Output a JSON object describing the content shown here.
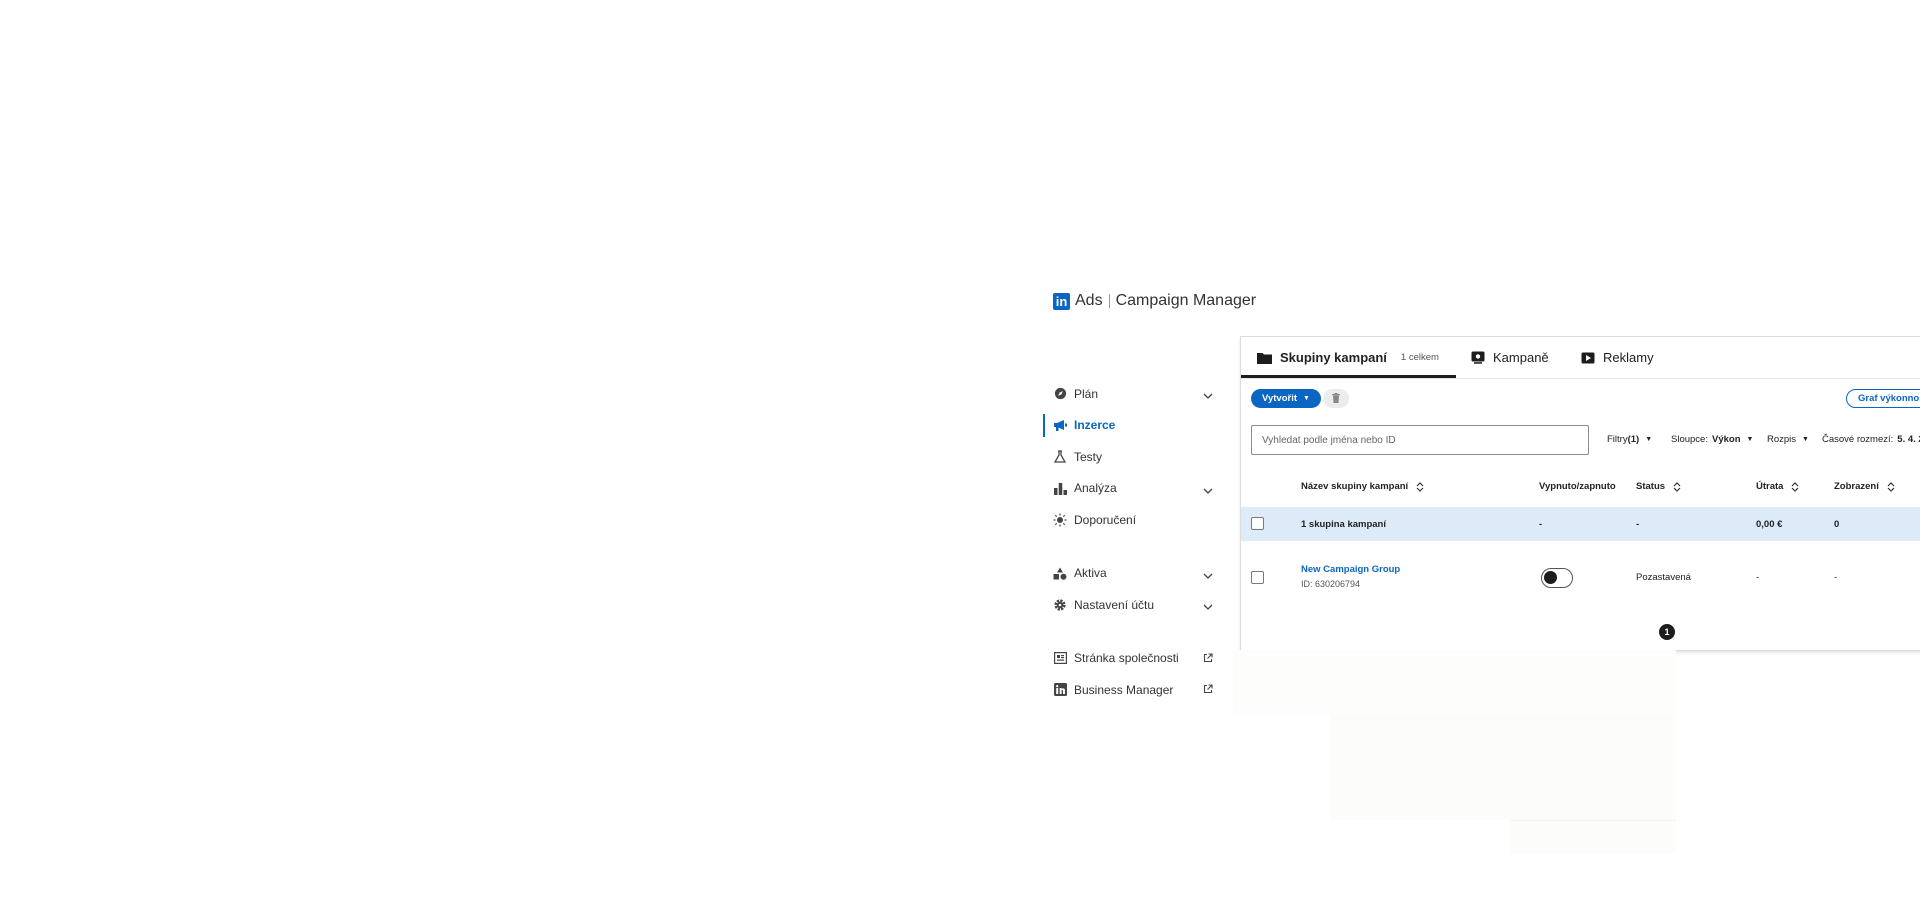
{
  "app": {
    "brand": "Ads",
    "product": "Campaign Manager",
    "logo_letters": "in"
  },
  "sidebar": {
    "items": [
      {
        "label": "Plán",
        "icon": "compass-icon",
        "expandable": true
      },
      {
        "label": "Inzerce",
        "icon": "megaphone-icon",
        "active": true
      },
      {
        "label": "Testy",
        "icon": "flask-icon"
      },
      {
        "label": "Analýza",
        "icon": "bar-chart-icon",
        "expandable": true
      },
      {
        "label": "Doporučení",
        "icon": "lightbulb-icon"
      },
      {
        "label": "Aktiva",
        "icon": "shapes-icon",
        "expandable": true
      },
      {
        "label": "Nastavení účtu",
        "icon": "gear-icon",
        "expandable": true
      },
      {
        "label": "Stránka společnosti",
        "icon": "company-page-icon",
        "external": true
      },
      {
        "label": "Business Manager",
        "icon": "linkedin-icon",
        "external": true
      }
    ]
  },
  "tabs": [
    {
      "label": "Skupiny kampaní",
      "count": "1 celkem",
      "icon": "folder-icon",
      "active": true
    },
    {
      "label": "Kampaně",
      "icon": "campaign-icon"
    },
    {
      "label": "Reklamy",
      "icon": "ad-icon"
    }
  ],
  "toolbar": {
    "create_label": "Vytvořit",
    "graph_label": "Graf výkonnosti"
  },
  "search": {
    "placeholder": "Vyhledat podle jména nebo ID"
  },
  "filters": {
    "filters_label": "Filtry",
    "filters_count": "(1)",
    "columns_label": "Sloupce:",
    "columns_value": "Výkon",
    "breakdown_label": "Rozpis",
    "timerange_label": "Časové rozmezí:",
    "timerange_value": "5. 4. 2"
  },
  "table": {
    "headers": [
      "Název skupiny kampaní",
      "Vypnuto/zapnuto",
      "Status",
      "Útrata",
      "Zobrazení"
    ],
    "summary": {
      "name": "1 skupina kampaní",
      "toggle": "-",
      "status": "-",
      "spend": "0,00 €",
      "impressions": "0"
    },
    "rows": [
      {
        "name": "New Campaign Group",
        "id": "ID: 630206794",
        "status": "Pozastavená",
        "spend": "-",
        "impressions": "-",
        "enabled": false
      }
    ]
  },
  "pagination": {
    "current": "1"
  },
  "colors": {
    "accent": "#0a66c2",
    "summary_row": "#dcebf7"
  }
}
